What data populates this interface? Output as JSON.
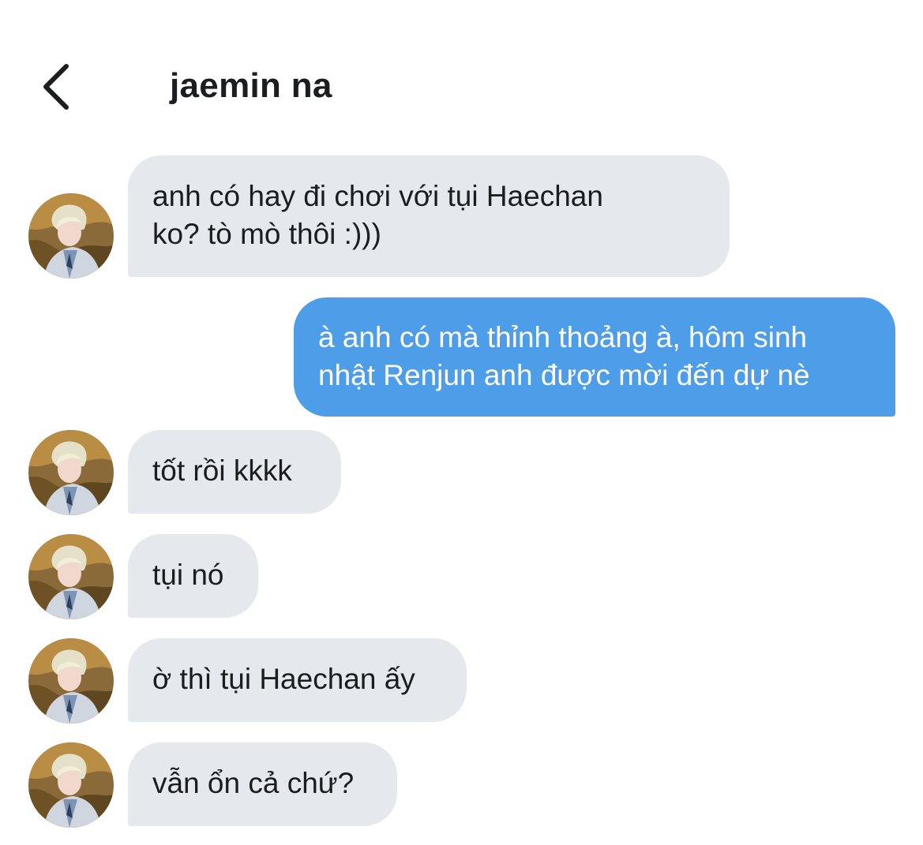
{
  "header": {
    "back_icon": "chevron-left-icon",
    "title": "jaemin na"
  },
  "colors": {
    "incoming_bubble": "#e5e9ee",
    "outgoing_bubble": "#4e9de8",
    "text": "#1c1d1f"
  },
  "messages": [
    {
      "direction": "incoming",
      "lines": [
        "anh có hay đi chơi với tụi Haechan",
        "ko? tò mò thôi :)))"
      ]
    },
    {
      "direction": "outgoing",
      "lines": [
        "à anh có mà thỉnh thoảng à, hôm sinh",
        "nhật Renjun anh được mời đến dự nè"
      ]
    },
    {
      "direction": "incoming",
      "lines": [
        "tốt rồi kkkk"
      ]
    },
    {
      "direction": "incoming",
      "lines": [
        "tụi nó"
      ]
    },
    {
      "direction": "incoming",
      "lines": [
        "ờ thì tụi Haechan ấy"
      ]
    },
    {
      "direction": "incoming",
      "lines": [
        "vẫn ổn cả chứ?"
      ]
    }
  ]
}
